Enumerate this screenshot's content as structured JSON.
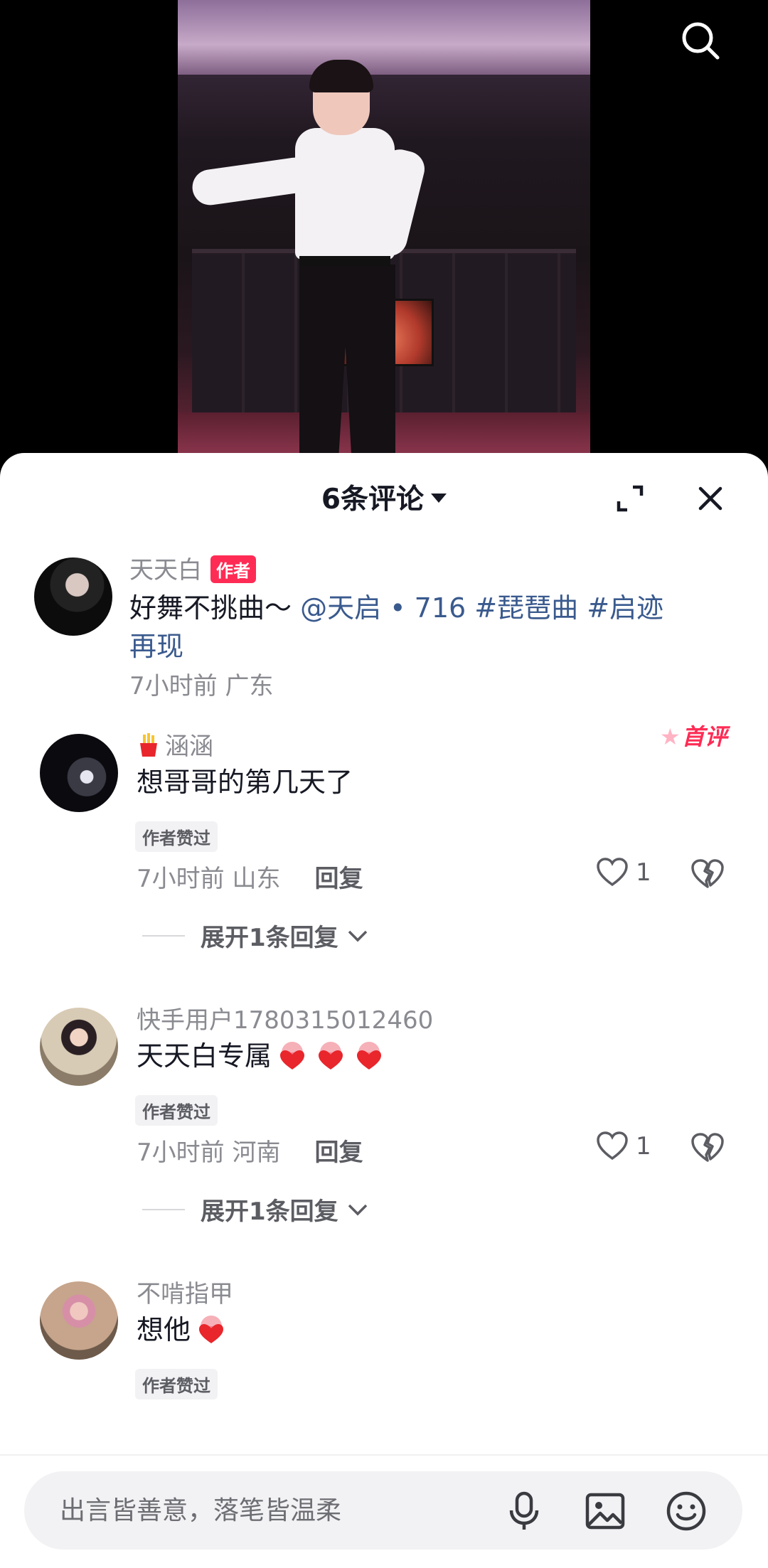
{
  "search": {
    "icon": "search-icon"
  },
  "sheet": {
    "title": "6条评论",
    "expand_icon": "expand-icon",
    "close_icon": "close-icon"
  },
  "comments": [
    {
      "username": "天天白",
      "author_badge": "作者",
      "text_plain": "好舞不挑曲～ ",
      "text_link": "@天启 • 716 #琵琶曲 #启迹",
      "text_link2": "再现",
      "meta": "7小时前 广东"
    },
    {
      "username": "涵涵",
      "first_badge": "首评",
      "text": "想哥哥的第几天了",
      "liked_tag": "作者赞过",
      "meta": "7小时前 山东",
      "reply_label": "回复",
      "likes": "1",
      "expand_label": "展开1条回复"
    },
    {
      "username": "快手用户1780315012460",
      "text": "天天白专属",
      "liked_tag": "作者赞过",
      "meta": "7小时前 河南",
      "reply_label": "回复",
      "likes": "1",
      "expand_label": "展开1条回复"
    },
    {
      "username": "不啃指甲",
      "text": "想他",
      "liked_tag": "作者赞过"
    }
  ],
  "input": {
    "placeholder": "出言皆善意，落笔皆温柔",
    "mic_icon": "microphone-icon",
    "image_icon": "image-icon",
    "emoji_icon": "emoji-icon"
  },
  "colors": {
    "accent": "#fe2c55",
    "link": "#3a5a8e",
    "meta": "#8a8b91"
  }
}
